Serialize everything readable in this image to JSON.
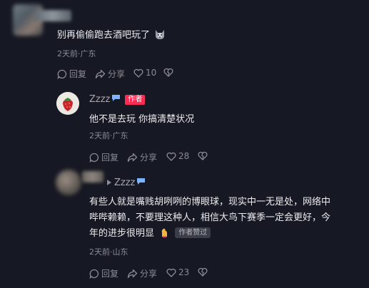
{
  "colors": {
    "background": "#161823",
    "text": "#ececf0",
    "muted": "#8a8b94",
    "author_badge": "#fe2c55",
    "liked_badge": "#3b3d48"
  },
  "comments": [
    {
      "text": "别再偷偷跑去酒吧玩了",
      "emoji_icon": "husky-face-icon",
      "meta": "2天前·广东",
      "actions": {
        "reply": "回复",
        "share": "分享",
        "likes": "10"
      }
    },
    {
      "username": "Zzzz",
      "author_badge": "作者",
      "text": "他不是去玩 你搞清楚状况",
      "meta": "2天前·广东",
      "actions": {
        "reply": "回复",
        "share": "分享",
        "likes": "28"
      }
    },
    {
      "reply_to": "Zzzz",
      "text_line1": "有些人就是嘴贱胡咧咧的博眼球，现实中一无是处，网络中",
      "text_line2": "哔哔赖赖，不要理这种人，相信大鸟下赛季一定会更好，今",
      "text_line3": "年的进步很明显",
      "liked_badge": "作者赞过",
      "meta": "2天前·山东",
      "actions": {
        "reply": "回复",
        "share": "分享",
        "likes": "23"
      }
    }
  ]
}
